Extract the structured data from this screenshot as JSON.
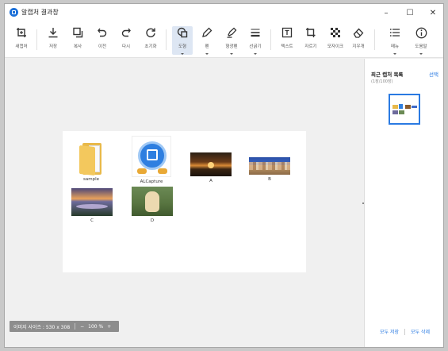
{
  "window": {
    "title": "알캡처 결과창",
    "controls": {
      "minimize": "–",
      "maximize": "☐",
      "close": "✕"
    }
  },
  "toolbar": {
    "tools": [
      {
        "id": "new-capture",
        "label": "새캡처",
        "icon": "new-capture-icon"
      },
      {
        "id": "save",
        "label": "저장",
        "icon": "download-icon"
      },
      {
        "id": "copy",
        "label": "복사",
        "icon": "copy-icon"
      },
      {
        "id": "undo",
        "label": "이전",
        "icon": "undo-icon"
      },
      {
        "id": "redo",
        "label": "다시",
        "icon": "redo-icon"
      },
      {
        "id": "reset",
        "label": "초기화",
        "icon": "reset-icon"
      },
      {
        "id": "shape",
        "label": "도형",
        "icon": "shape-icon",
        "active": true
      },
      {
        "id": "pen",
        "label": "펜",
        "icon": "pen-icon"
      },
      {
        "id": "highlighter",
        "label": "형광펜",
        "icon": "highlighter-icon"
      },
      {
        "id": "line-thickness",
        "label": "선굵기",
        "icon": "line-thickness-icon"
      },
      {
        "id": "text",
        "label": "텍스트",
        "icon": "text-icon"
      },
      {
        "id": "crop",
        "label": "자르기",
        "icon": "crop-icon"
      },
      {
        "id": "mosaic",
        "label": "모자이크",
        "icon": "mosaic-icon"
      },
      {
        "id": "eraser",
        "label": "지우개",
        "icon": "eraser-icon"
      },
      {
        "id": "menu",
        "label": "메뉴",
        "icon": "menu-icon"
      },
      {
        "id": "help",
        "label": "도움말",
        "icon": "info-icon"
      }
    ]
  },
  "canvas": {
    "items": [
      {
        "name": "sample",
        "kind": "folder"
      },
      {
        "name": "ALCapture",
        "kind": "app-icon"
      },
      {
        "name": "A",
        "kind": "photo"
      },
      {
        "name": "B",
        "kind": "photo"
      },
      {
        "name": "C",
        "kind": "photo"
      },
      {
        "name": "D",
        "kind": "photo"
      }
    ]
  },
  "statusbar": {
    "image_size": "이미지 사이즈 : 530 x 308",
    "zoom_out": "−",
    "zoom": "100 %",
    "zoom_in": "+"
  },
  "right_panel": {
    "title": "최근 캡처 목록",
    "select_label": "선택",
    "count": "(1장/100장)",
    "save_all": "모두 저장",
    "delete_all": "모두 삭제"
  },
  "colors": {
    "accent": "#2a7ae2",
    "active_tool_bg": "#dde6f3",
    "statusbar_bg": "#8d8d8d"
  }
}
